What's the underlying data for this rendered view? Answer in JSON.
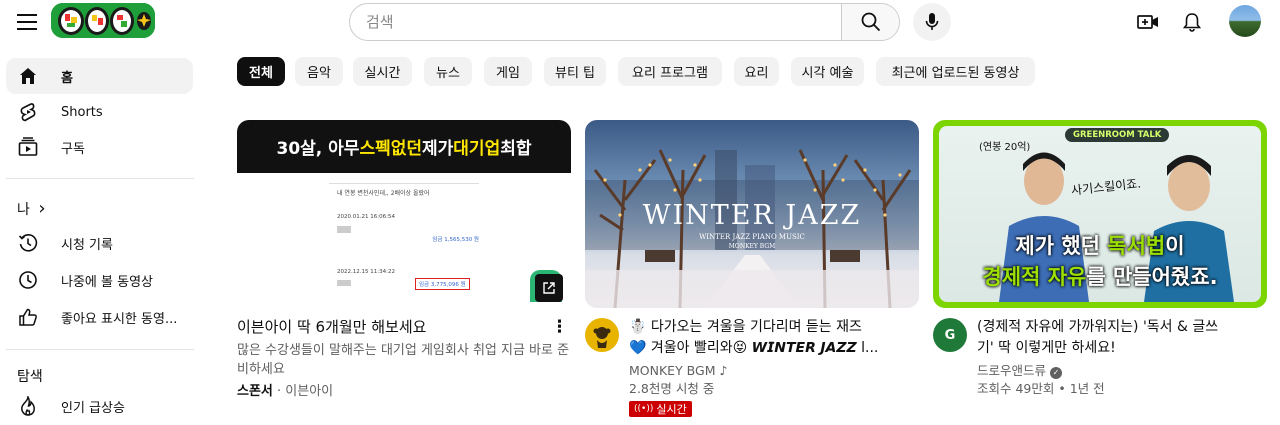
{
  "header": {
    "search_placeholder": "검색"
  },
  "sidebar": {
    "home": "홈",
    "shorts": "Shorts",
    "subscriptions": "구독",
    "you_heading": "나",
    "you_chevron": "›",
    "history": "시청 기록",
    "watch_later": "나중에 볼 동영상",
    "liked": "좋아요 표시한 동영...",
    "explore_heading": "탐색",
    "trending": "인기 급상승"
  },
  "chips": [
    "전체",
    "음악",
    "실시간",
    "뉴스",
    "게임",
    "뷰티 팁",
    "요리 프로그램",
    "요리",
    "시각 예술",
    "최근에 업로드된 동영상"
  ],
  "videos": [
    {
      "thumb_banner_white": "30살, 아무 ",
      "thumb_banner_yellow1": "스펙없던",
      "thumb_banner_white2": " 제가 ",
      "thumb_banner_yellow2": "대기업",
      "thumb_banner_white3": " 최합",
      "thumb_mock_title": "내 연봉 변천사인데,, 2배이상 올랐어",
      "thumb_mock_date1": "2020.01.21 16:06:54",
      "thumb_mock_amount1": "임금 1,565,530 원",
      "thumb_mock_date2": "2022.12.15 11:34:22",
      "thumb_mock_amount2": "임금 3,775,096 원",
      "title": "이븐아이 딱 6개월만 해보세요",
      "description": "많은 수강생들이 말해주는 대기업 게임회사 취업 지금 바로 준비하세요",
      "sponsor_label": "스폰서",
      "sponsor_sep": " · ",
      "sponsor_name": "이븐아이",
      "more_label": "⋮"
    },
    {
      "thumb_title": "WINTER JAZZ",
      "thumb_subtitle": "WINTER JAZZ PIANO MUSIC",
      "thumb_subtitle2": "MONKEY BGM",
      "title_line1": "☃️ 다가오는 겨울을 기다리며 듣는 재즈",
      "title_line2": "💙 겨울아 빨리와😝 𝙒𝙄𝙉𝙏𝙀𝙍 𝙅𝘼𝙕𝙕 l...",
      "channel": "MONKEY BGM",
      "channel_badge": "♪",
      "stats": "2.8천명 시청 중",
      "live_label": "실시간"
    },
    {
      "thumb_tag": "GREENROOM TALK",
      "thumb_small": "(연봉 20억)",
      "thumb_handwrite": "사기스킬이죠.",
      "thumb_line1_a": "제가 했던 ",
      "thumb_line1_b": "독서법",
      "thumb_line1_c": "이",
      "thumb_line2_a": "경제적 자유",
      "thumb_line2_b": "를 만들어줬죠.",
      "title_line1": "(경제적 자유에 가까워지는) '독서 & 글쓰",
      "title_line2": "기' 딱 이렇게만 하세요!",
      "channel": "드로우앤드류",
      "channel_badge": "✓",
      "stats": "조회수 49만회 • 1년 전",
      "avatar_letter": "G"
    }
  ],
  "colors": {
    "accent": "#0f0f0f",
    "live": "#cc0000",
    "highlight_yellow": "#ffe600",
    "highlight_green": "#7cd400",
    "logo_bg": "#1f9f3a"
  }
}
